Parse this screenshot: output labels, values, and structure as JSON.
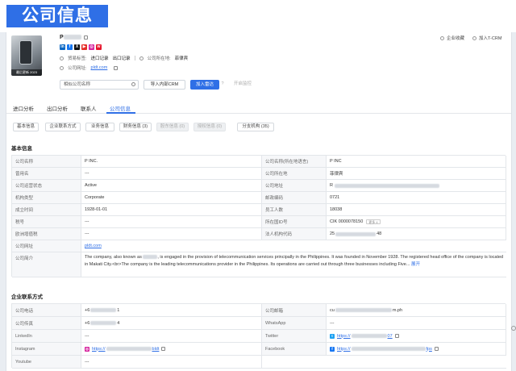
{
  "banner": {
    "title": "公司信息"
  },
  "company": {
    "name_initial": "P",
    "thumb_caption": "最后更新 2023",
    "exporter_label": "贸易标签:",
    "export_record": "进口记录",
    "import_record": "出口记录",
    "country_label": "公司所在地:",
    "country": "菲律宾",
    "website_label": "公司网址:",
    "website": "pldt.com",
    "socials": [
      {
        "name": "linkedin",
        "color": "#0a66c2",
        "glyph": "in"
      },
      {
        "name": "facebook",
        "color": "#1877f2",
        "glyph": "f"
      },
      {
        "name": "twitter-x",
        "color": "#111111",
        "glyph": "X"
      },
      {
        "name": "youtube",
        "color": "#e52d27",
        "glyph": "▶"
      },
      {
        "name": "instagram",
        "color": "#d6249f",
        "glyph": "◎"
      },
      {
        "name": "weibo",
        "color": "#e6162d",
        "glyph": "w"
      }
    ]
  },
  "header_actions": {
    "favorite": "企业收藏",
    "add_crm": "加入T-CRM"
  },
  "toolbar": {
    "search_placeholder": "相似公司名称",
    "import_crm": "导入内部CRM",
    "add_monitor": "加入雷达",
    "info_icon": "?",
    "batch_export": "开启监控"
  },
  "tabs": [
    "进口分析",
    "出口分析",
    "联系人",
    "公司信息"
  ],
  "active_tab": "公司信息",
  "chips": [
    {
      "label": "基本信息",
      "disabled": false
    },
    {
      "label": "企业联系方式",
      "disabled": false
    },
    {
      "label": "业务信息",
      "disabled": false
    },
    {
      "label": "财务信息 (3)",
      "disabled": false
    },
    {
      "label": "股东信息 (0)",
      "disabled": true
    },
    {
      "label": "授权信息 (0)",
      "disabled": true
    },
    {
      "label": "分支机构 (35)",
      "disabled": false
    }
  ],
  "basic": {
    "title": "基本信息",
    "rows": [
      {
        "l1": "公司名称",
        "v1": "P     INC.",
        "l2": "公司名称(所在地语言)",
        "v2": "P     INC"
      },
      {
        "l1": "曾用名",
        "v1": "---",
        "l2": "公司所在地",
        "v2": "菲律宾"
      },
      {
        "l1": "公司运营状态",
        "v1": "Active",
        "l2": "公司地址",
        "v2": "R"
      },
      {
        "l1": "机构类型",
        "v1": "Corporate",
        "l2": "邮政编码",
        "v2": "0721"
      },
      {
        "l1": "成立时间",
        "v1": "1928-01-01",
        "l2": "员工人数",
        "v2": "18038"
      },
      {
        "l1": "税号",
        "v1": "---",
        "l2": "所在国ID号",
        "v2": "CIK 0000078150",
        "badge": "更多 4"
      },
      {
        "l1": "欧洲增值税",
        "v1": "---",
        "l2": "法人机构代码",
        "v2": "25",
        "v2b": "48"
      }
    ],
    "website_label": "公司网址",
    "website": "pldt.com",
    "profile_label": "公司简介",
    "profile_a": "The company, also known as",
    "profile_b": ", is engaged in the provision of telecommunication services principally in the Philippines. It was founded in November 1928. The registered head office of the company is located in Makati City.<br>The company is the leading telecommunications provider in the Philippines. Its operations are carried out through three businesses including Five...",
    "more": "展开"
  },
  "contacts": {
    "title": "企业联系方式",
    "rows": [
      {
        "l1": "公司电话",
        "v1": "+6",
        "v1b": "1",
        "l2": "公司邮箱",
        "v2": "cu",
        "v2b": "m.ph"
      },
      {
        "l1": "公司传真",
        "v1": "+6",
        "v1b": "4",
        "l2": "WhatsApp",
        "v2": "---"
      },
      {
        "l1": "LinkedIn",
        "v1": "---",
        "l2": "Twitter",
        "v2": "https://",
        "v2b": "07"
      },
      {
        "l1": "Instagram",
        "v1": "https://",
        "v1b": "bldt",
        "l2": "Facebook",
        "v2": "https://",
        "v2b": "fps"
      },
      {
        "l1": "Youtube",
        "v1": "---"
      }
    ]
  }
}
